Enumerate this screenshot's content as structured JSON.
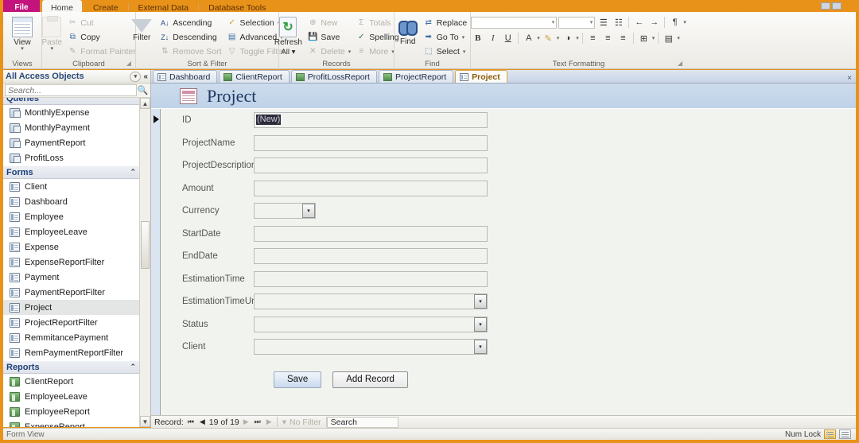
{
  "ribbon": {
    "tabs": [
      {
        "label": "File",
        "active": false,
        "file": true
      },
      {
        "label": "Home",
        "active": true
      },
      {
        "label": "Create",
        "active": false
      },
      {
        "label": "External Data",
        "active": false
      },
      {
        "label": "Database Tools",
        "active": false
      }
    ],
    "groups": {
      "views": {
        "name": "Views",
        "button": {
          "label": "View",
          "arrow": "▾",
          "icon": "datasheet-view-icon"
        }
      },
      "clipboard": {
        "name": "Clipboard",
        "paste": {
          "label": "Paste",
          "arrow": "▾",
          "icon": "paste-icon"
        },
        "items": [
          {
            "label": "Cut",
            "icon": "scissors-icon",
            "enabled": false,
            "glyph": "✂"
          },
          {
            "label": "Copy",
            "icon": "copy-icon",
            "enabled": true,
            "glyph": "⧉"
          },
          {
            "label": "Format Painter",
            "icon": "format-painter-icon",
            "enabled": false,
            "glyph": "✎"
          }
        ]
      },
      "sortfilter": {
        "name": "Sort & Filter",
        "filter": {
          "label": "Filter",
          "icon": "funnel-icon"
        },
        "col1": [
          {
            "label": "Ascending",
            "icon": "sort-ascending-icon",
            "enabled": true,
            "glyph": "A↓"
          },
          {
            "label": "Descending",
            "icon": "sort-descending-icon",
            "enabled": true,
            "glyph": "Z↓"
          },
          {
            "label": "Remove Sort",
            "icon": "remove-sort-icon",
            "enabled": false,
            "glyph": "⇅"
          }
        ],
        "col2": [
          {
            "label": "Selection",
            "icon": "selection-icon",
            "enabled": true,
            "caret": "▾",
            "glyph": "✓"
          },
          {
            "label": "Advanced",
            "icon": "advanced-filter-icon",
            "enabled": true,
            "caret": "▾",
            "glyph": "▤"
          },
          {
            "label": "Toggle Filter",
            "icon": "toggle-filter-icon",
            "enabled": false,
            "glyph": "▽"
          }
        ]
      },
      "records": {
        "name": "Records",
        "refresh": {
          "label1": "Refresh",
          "label2": "All",
          "arrow": "▾",
          "icon": "refresh-all-icon"
        },
        "col1": [
          {
            "label": "New",
            "icon": "new-record-icon",
            "enabled": false,
            "glyph": "⊕"
          },
          {
            "label": "Save",
            "icon": "save-record-icon",
            "enabled": true,
            "glyph": "Ὃe"
          },
          {
            "label": "Delete",
            "icon": "delete-record-icon",
            "enabled": false,
            "caret": "▾",
            "glyph": "✕"
          }
        ],
        "col2": [
          {
            "label": "Totals",
            "icon": "totals-icon",
            "enabled": false,
            "glyph": "Σ"
          },
          {
            "label": "Spelling",
            "icon": "spelling-icon",
            "enabled": true,
            "glyph": "✓"
          },
          {
            "label": "More",
            "icon": "more-icon",
            "enabled": false,
            "caret": "▾",
            "glyph": "≡"
          }
        ]
      },
      "find": {
        "name": "Find",
        "findbtn": {
          "label": "Find",
          "icon": "binoculars-icon"
        },
        "items": [
          {
            "label": "Replace",
            "icon": "replace-icon",
            "enabled": true,
            "glyph": "⇄"
          },
          {
            "label": "Go To",
            "icon": "go-to-icon",
            "enabled": true,
            "caret": "▾",
            "glyph": "➡"
          },
          {
            "label": "Select",
            "icon": "select-icon",
            "enabled": true,
            "caret": "▾",
            "glyph": "⬚"
          }
        ]
      },
      "textformatting": {
        "name": "Text Formatting",
        "font_name": "",
        "font_size": "",
        "buttons": [
          {
            "name": "bullets-button",
            "glyph": "☰"
          },
          {
            "name": "numbering-button",
            "glyph": "☷"
          },
          {
            "name": "decrease-indent-button",
            "glyph": "←"
          },
          {
            "name": "increase-indent-button",
            "glyph": "→"
          },
          {
            "name": "text-direction-button",
            "glyph": "¶",
            "caret": "▾"
          }
        ],
        "row2": [
          {
            "name": "bold-button",
            "glyph": "B"
          },
          {
            "name": "italic-button",
            "glyph": "I"
          },
          {
            "name": "underline-button",
            "glyph": "U"
          },
          {
            "name": "font-color-button",
            "glyph": "A",
            "caret": "▾"
          },
          {
            "name": "highlight-color-button",
            "glyph": "✎",
            "caret": "▾"
          },
          {
            "name": "background-color-button",
            "glyph": "◑",
            "caret": "▾"
          },
          {
            "name": "align-left-button",
            "glyph": "≡"
          },
          {
            "name": "align-center-button",
            "glyph": "≡"
          },
          {
            "name": "align-right-button",
            "glyph": "≡"
          },
          {
            "name": "gridlines-button",
            "glyph": "⊞",
            "caret": "▾"
          },
          {
            "name": "alternate-row-color-button",
            "glyph": "▤",
            "caret": "▾"
          }
        ]
      }
    }
  },
  "navpane": {
    "title": "All Access Objects",
    "menu_icon": "▾",
    "collapse_icon": "«",
    "search": {
      "placeholder": "Search...",
      "value": "",
      "icon": "search-icon"
    },
    "groups": [
      {
        "label": "Queries",
        "collapse": "⌃",
        "partial": true,
        "items": [
          {
            "label": "MonthlyExpense",
            "type": "query"
          },
          {
            "label": "MonthlyPayment",
            "type": "query"
          },
          {
            "label": "PaymentReport",
            "type": "query"
          },
          {
            "label": "ProfitLoss",
            "type": "query"
          }
        ]
      },
      {
        "label": "Forms",
        "collapse": "⌃",
        "items": [
          {
            "label": "Client",
            "type": "form"
          },
          {
            "label": "Dashboard",
            "type": "form"
          },
          {
            "label": "Employee",
            "type": "form"
          },
          {
            "label": "EmployeeLeave",
            "type": "form"
          },
          {
            "label": "Expense",
            "type": "form"
          },
          {
            "label": "ExpenseReportFilter",
            "type": "form"
          },
          {
            "label": "Payment",
            "type": "form"
          },
          {
            "label": "PaymentReportFilter",
            "type": "form"
          },
          {
            "label": "Project",
            "type": "form",
            "selected": true
          },
          {
            "label": "ProjectReportFilter",
            "type": "form"
          },
          {
            "label": "RemmitancePayment",
            "type": "form"
          },
          {
            "label": "RemPaymentReportFilter",
            "type": "form"
          }
        ]
      },
      {
        "label": "Reports",
        "collapse": "⌃",
        "items": [
          {
            "label": "ClientReport",
            "type": "report"
          },
          {
            "label": "EmployeeLeave",
            "type": "report"
          },
          {
            "label": "EmployeeReport",
            "type": "report"
          },
          {
            "label": "ExpenseReport",
            "type": "report"
          }
        ]
      }
    ]
  },
  "doctabs": {
    "tabs": [
      {
        "label": "Dashboard",
        "type": "form",
        "active": false
      },
      {
        "label": "ClientReport",
        "type": "report",
        "active": false
      },
      {
        "label": "ProfitLossReport",
        "type": "report",
        "active": false
      },
      {
        "label": "ProjectReport",
        "type": "report",
        "active": false
      },
      {
        "label": "Project",
        "type": "form",
        "active": true
      }
    ],
    "close_icon": "×"
  },
  "form": {
    "title": "Project",
    "title_icon": "form-icon",
    "fields": [
      {
        "label": "ID",
        "control": "text",
        "value": "(New)",
        "selected": true
      },
      {
        "label": "ProjectName",
        "control": "text",
        "value": ""
      },
      {
        "label": "ProjectDescription",
        "control": "text",
        "value": ""
      },
      {
        "label": "Amount",
        "control": "text",
        "value": ""
      },
      {
        "label": "Currency",
        "control": "combo-narrow",
        "value": ""
      },
      {
        "label": "StartDate",
        "control": "text",
        "value": ""
      },
      {
        "label": "EndDate",
        "control": "text",
        "value": ""
      },
      {
        "label": "EstimationTime",
        "control": "text",
        "value": ""
      },
      {
        "label": "EstimationTimeUnit",
        "control": "combo",
        "value": ""
      },
      {
        "label": "Status",
        "control": "combo",
        "value": ""
      },
      {
        "label": "Client",
        "control": "combo",
        "value": ""
      }
    ],
    "buttons": [
      {
        "label": "Save",
        "style": "primary"
      },
      {
        "label": "Add Record",
        "style": "alt"
      }
    ],
    "dropdown_arrow": "▾"
  },
  "recordnav": {
    "label": "Record:",
    "first_icon": "⏮",
    "prev_icon": "◀",
    "position": "19 of 19",
    "next_icon": "▶",
    "last_icon": "⏭",
    "new_icon": "▶",
    "filter_icon": "filter-icon",
    "filter_text": "No Filter",
    "search_text": "Search"
  },
  "statusbar": {
    "left_text": "Form View",
    "right_text": "Num Lock",
    "view_buttons": [
      {
        "name": "form-view-button",
        "active": true
      },
      {
        "name": "design-view-button",
        "active": false
      }
    ]
  }
}
